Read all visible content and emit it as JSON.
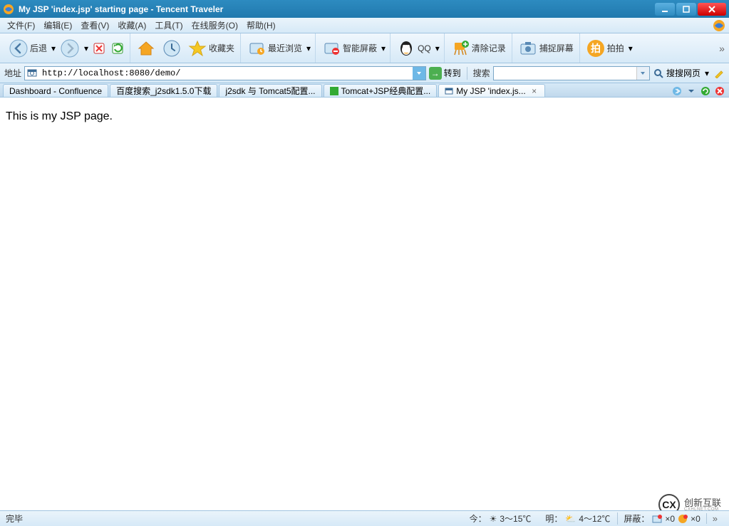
{
  "titlebar": {
    "title": "My JSP 'index.jsp' starting page - Tencent Traveler"
  },
  "menu": {
    "items": [
      "文件(F)",
      "编辑(E)",
      "查看(V)",
      "收藏(A)",
      "工具(T)",
      "在线服务(O)",
      "帮助(H)"
    ]
  },
  "toolbar": {
    "back": "后退",
    "favorites": "收藏夹",
    "recent": "最近浏览",
    "smart_block": "智能屏蔽",
    "qq": "QQ",
    "clear": "清除记录",
    "capture": "捕捉屏幕",
    "paipai": "拍拍"
  },
  "addressbar": {
    "label": "地址",
    "url": "http://localhost:8080/demo/",
    "go": "转到",
    "search_label": "搜索",
    "search_go": "搜搜网页"
  },
  "tabs": [
    {
      "label": "Dashboard - Confluence"
    },
    {
      "label": "百度搜索_j2sdk1.5.0下载"
    },
    {
      "label": "j2sdk 与 Tomcat5配置..."
    },
    {
      "label": "Tomcat+JSP经典配置..."
    },
    {
      "label": "My JSP 'index.js...",
      "active": true
    }
  ],
  "page": {
    "body": "This is my JSP page."
  },
  "status": {
    "text": "完毕",
    "weather_today_label": "今：",
    "weather_today": "3～15℃",
    "weather_tomorrow_label": "明：",
    "weather_tomorrow": "4～12℃",
    "block_label": "屏蔽：",
    "block_popup": "×0",
    "block_float": "×0"
  },
  "watermark": {
    "main": "创新互联",
    "sub": "CXHLNET.COM"
  }
}
